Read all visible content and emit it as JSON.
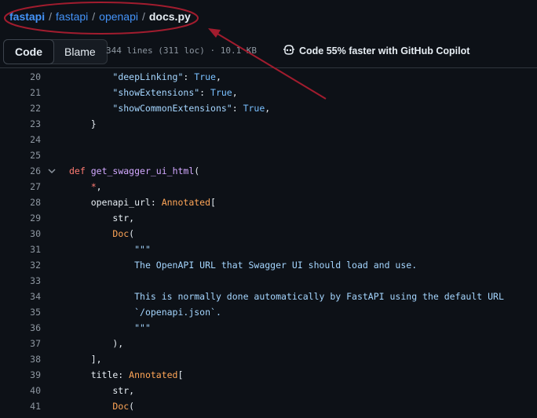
{
  "breadcrumb": {
    "repo_owner": "fastapi",
    "repo": "fastapi",
    "folder": "openapi",
    "file": "docs.py",
    "separator": "/"
  },
  "toolbar": {
    "code_tab": "Code",
    "blame_tab": "Blame",
    "meta": "344 lines (311 loc) · 10.1 KB",
    "copilot": "Code 55% faster with GitHub Copilot"
  },
  "code_lines": [
    {
      "n": "20",
      "html": "        <span class='s'>\"deepLinking\"</span>: <span class='c'>True</span>,"
    },
    {
      "n": "21",
      "html": "        <span class='s'>\"showExtensions\"</span>: <span class='c'>True</span>,"
    },
    {
      "n": "22",
      "html": "        <span class='s'>\"showCommonExtensions\"</span>: <span class='c'>True</span>,"
    },
    {
      "n": "23",
      "html": "    }"
    },
    {
      "n": "24",
      "html": ""
    },
    {
      "n": "25",
      "html": ""
    },
    {
      "n": "26",
      "html": "<span class='k'>def</span> <span class='f'>get_swagger_ui_html</span>(",
      "fold": true
    },
    {
      "n": "27",
      "html": "    <span class='k'>*</span>,"
    },
    {
      "n": "28",
      "html": "    openapi_url: <span class='t'>Annotated</span>["
    },
    {
      "n": "29",
      "html": "        str,"
    },
    {
      "n": "30",
      "html": "        <span class='t'>Doc</span>("
    },
    {
      "n": "31",
      "html": "            <span class='s'>\"\"\"</span>"
    },
    {
      "n": "32",
      "html": "            <span class='s'>The OpenAPI URL that Swagger UI should load and use.</span>"
    },
    {
      "n": "33",
      "html": ""
    },
    {
      "n": "34",
      "html": "            <span class='s'>This is normally done automatically by FastAPI using the default URL</span>"
    },
    {
      "n": "35",
      "html": "            <span class='s'>`/openapi.json`.</span>"
    },
    {
      "n": "36",
      "html": "            <span class='s'>\"\"\"</span>"
    },
    {
      "n": "37",
      "html": "        ),"
    },
    {
      "n": "38",
      "html": "    ],"
    },
    {
      "n": "39",
      "html": "    title: <span class='t'>Annotated</span>["
    },
    {
      "n": "40",
      "html": "        str,"
    },
    {
      "n": "41",
      "html": "        <span class='t'>Doc</span>("
    }
  ],
  "colors": {
    "annotation": "#a11c2e",
    "link": "#4493f8",
    "background": "#0d1117"
  },
  "icons": {
    "fold": "chevron-down-icon",
    "copilot": "copilot-icon"
  }
}
